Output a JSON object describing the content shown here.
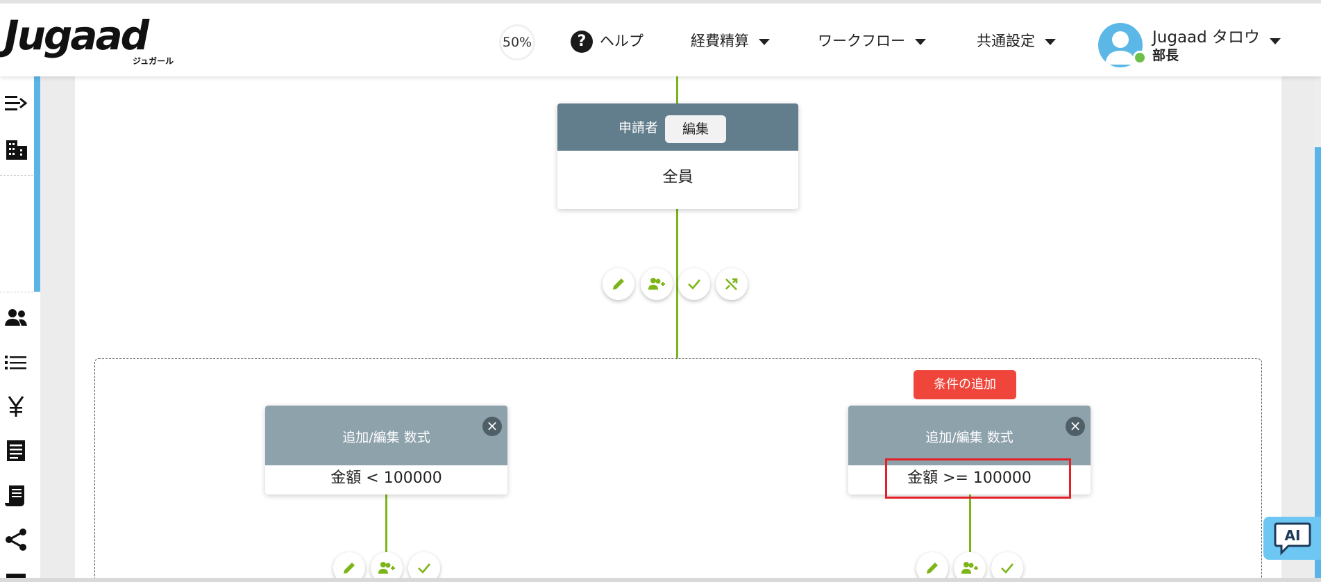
{
  "brand": {
    "logo": "Jugaad",
    "sub": "ジュガール"
  },
  "header": {
    "zoom": "50%",
    "help": "ヘルプ",
    "menu": [
      "経費精算",
      "ワークフロー",
      "共通設定"
    ],
    "user": {
      "name": "Jugaad タロウ",
      "role": "部長"
    }
  },
  "sidebar": {
    "icons": [
      "menu-expand-icon",
      "building-icon",
      "users-icon",
      "list-icon",
      "yen-icon",
      "receipt-icon",
      "invoice-icon",
      "share-icon",
      "table-icon"
    ]
  },
  "workflow": {
    "applicant": {
      "title": "申請者",
      "edit_label": "編集",
      "value": "全員"
    },
    "add_condition_label": "条件の追加",
    "conditions": [
      {
        "title": "追加/編集 数式",
        "formula": "金額 < 100000"
      },
      {
        "title": "追加/編集 数式",
        "formula": "金額 >= 100000"
      }
    ],
    "actions": [
      "edit-icon",
      "add-approver-icon",
      "check-icon",
      "branch-icon"
    ]
  },
  "ai_button": "AI",
  "colors": {
    "line": "#7cb518",
    "node_header": "#627d8b",
    "condition_header": "#8ea2ac",
    "add_condition": "#f0453a",
    "accent": "#5ab4e8",
    "highlight": "#e32028"
  }
}
